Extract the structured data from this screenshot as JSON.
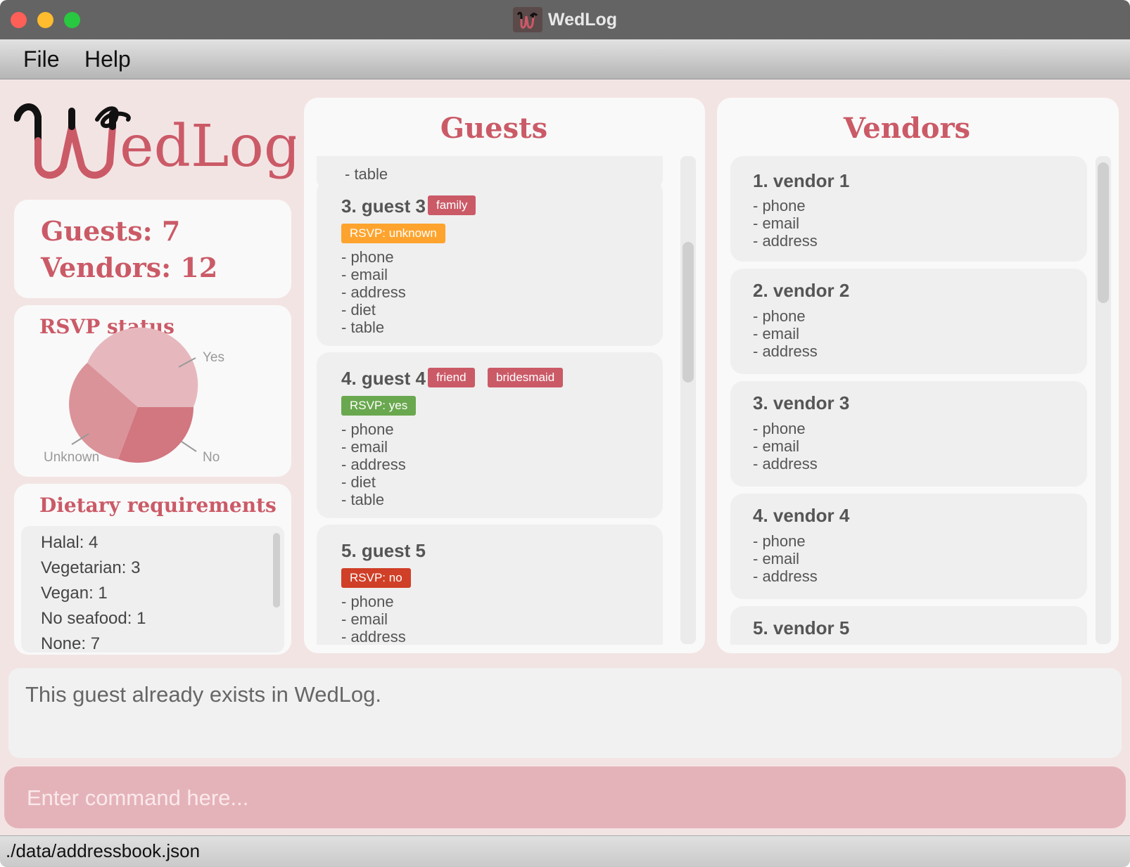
{
  "window": {
    "title": "WedLog"
  },
  "menu": {
    "file": "File",
    "help": "Help"
  },
  "logo": {
    "text": "WedLog"
  },
  "stats": {
    "guests": "Guests: 7",
    "vendors": "Vendors: 12"
  },
  "rsvp": {
    "title": "RSVP status",
    "labels": {
      "yes": "Yes",
      "no": "No",
      "unknown": "Unknown"
    },
    "colors": {
      "yes": "#e6b8be",
      "no": "#d2767f",
      "unknown": "#da9399"
    }
  },
  "diet": {
    "title": "Dietary requirements",
    "items": [
      "Halal: 4",
      "Vegetarian: 3",
      "Vegan: 1",
      "No seafood: 1",
      "None: 7"
    ]
  },
  "guests_panel": {
    "title": "Guests",
    "partial_top_field": "- table",
    "guests": [
      {
        "name": "3. guest 3",
        "tags": [
          "family"
        ],
        "rsvp": "RSVP: unknown",
        "fields": [
          "- phone",
          "- email",
          "- address",
          "- diet",
          "- table"
        ]
      },
      {
        "name": "4. guest 4",
        "tags": [
          "friend",
          "bridesmaid"
        ],
        "rsvp": "RSVP: yes",
        "fields": [
          "- phone",
          "- email",
          "- address",
          "- diet",
          "- table"
        ]
      },
      {
        "name": "5. guest 5",
        "tags": [],
        "rsvp": "RSVP: no",
        "fields": [
          "- phone",
          "- email",
          "- address"
        ]
      }
    ]
  },
  "vendors_panel": {
    "title": "Vendors",
    "vendors": [
      {
        "name": "1. vendor 1",
        "fields": [
          "- phone",
          "- email",
          "- address"
        ]
      },
      {
        "name": "2. vendor 2",
        "fields": [
          "- phone",
          "- email",
          "- address"
        ]
      },
      {
        "name": "3. vendor 3",
        "fields": [
          "- phone",
          "- email",
          "- address"
        ]
      },
      {
        "name": "4. vendor 4",
        "fields": [
          "- phone",
          "- email",
          "- address"
        ]
      },
      {
        "name": "5. vendor 5",
        "fields": []
      }
    ]
  },
  "result": {
    "message": "This guest already exists in WedLog."
  },
  "command": {
    "placeholder": "Enter command here..."
  },
  "status": {
    "path": "./data/addressbook.json"
  },
  "colors": {
    "accent": "#cb5a67",
    "tag": "#cb5a67",
    "rsvp_unknown": "#fea42e",
    "rsvp_yes": "#6aa84f",
    "rsvp_no": "#d03f27"
  }
}
